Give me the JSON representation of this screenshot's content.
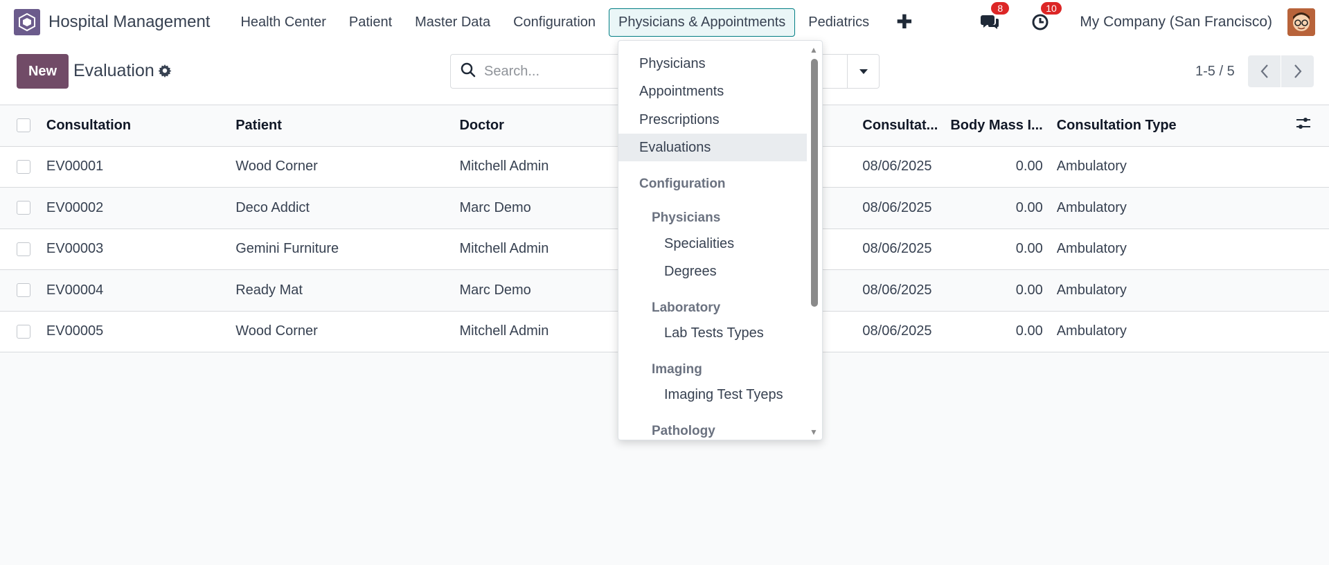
{
  "navbar": {
    "app_title": "Hospital Management",
    "menu": [
      "Health Center",
      "Patient",
      "Master Data",
      "Configuration",
      "Physicians & Appointments",
      "Pediatrics"
    ],
    "active_menu": "Physicians & Appointments",
    "messages_count": "8",
    "activities_count": "10",
    "company": "My Company (San Francisco)"
  },
  "control_panel": {
    "new_label": "New",
    "title": "Evaluation",
    "search_placeholder": "Search...",
    "pager": "1-5 / 5"
  },
  "table": {
    "columns": [
      "Consultation",
      "Patient",
      "Doctor",
      "Consultat...",
      "Body Mass I...",
      "Consultation Type"
    ],
    "rows": [
      [
        "EV00001",
        "Wood Corner",
        "Mitchell Admin",
        "08/06/2025",
        "0.00",
        "Ambulatory"
      ],
      [
        "EV00002",
        "Deco Addict",
        "Marc Demo",
        "08/06/2025",
        "0.00",
        "Ambulatory"
      ],
      [
        "EV00003",
        "Gemini Furniture",
        "Mitchell Admin",
        "08/06/2025",
        "0.00",
        "Ambulatory"
      ],
      [
        "EV00004",
        "Ready Mat",
        "Marc Demo",
        "08/06/2025",
        "0.00",
        "Ambulatory"
      ],
      [
        "EV00005",
        "Wood Corner",
        "Mitchell Admin",
        "08/06/2025",
        "0.00",
        "Ambulatory"
      ]
    ]
  },
  "dropdown": {
    "items": [
      "Physicians",
      "Appointments",
      "Prescriptions",
      "Evaluations"
    ],
    "selected": "Evaluations",
    "config_header": "Configuration",
    "physicians_header": "Physicians",
    "physicians_items": [
      "Specialities",
      "Degrees"
    ],
    "laboratory_header": "Laboratory",
    "laboratory_items": [
      "Lab Tests Types"
    ],
    "imaging_header": "Imaging",
    "imaging_items": [
      "Imaging Test Tyeps"
    ],
    "pathology_header": "Pathology"
  },
  "colors": {
    "brand": "#714b67",
    "active_menu_border": "#017e84",
    "badge": "#dc2626"
  },
  "icons": [
    "app-logo-icon",
    "plus-icon",
    "chat-icon",
    "clock-icon",
    "avatar",
    "gear-icon",
    "search-icon",
    "caret-down-icon",
    "chevron-left-icon",
    "chevron-right-icon",
    "column-settings-icon"
  ]
}
